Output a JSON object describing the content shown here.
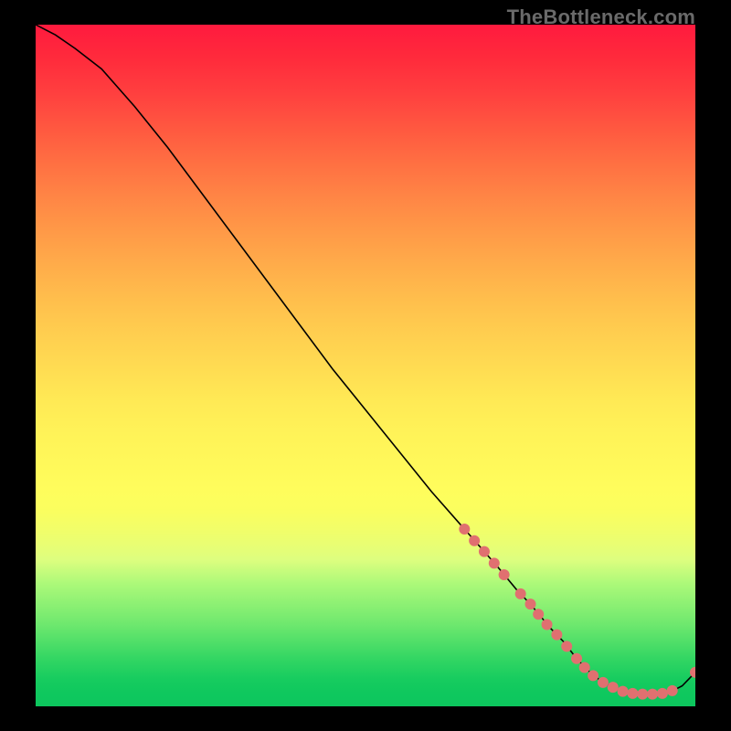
{
  "watermark": "TheBottleneck.com",
  "colors": {
    "gradient_top": "#ff1a3e",
    "gradient_mid": "#fff95a",
    "gradient_bottom": "#0cc65d",
    "line": "#000000",
    "marker": "#e07070",
    "background": "#000000"
  },
  "chart_data": {
    "type": "line",
    "title": "",
    "xlabel": "",
    "ylabel": "",
    "xlim": [
      0,
      100
    ],
    "ylim": [
      0,
      100
    ],
    "x": [
      0,
      3,
      6,
      10,
      15,
      20,
      25,
      30,
      35,
      40,
      45,
      50,
      55,
      60,
      65,
      70,
      73,
      75,
      78,
      80,
      82,
      84,
      86,
      88,
      90,
      92,
      94,
      96,
      98,
      100
    ],
    "y": [
      100,
      98.5,
      96.5,
      93.5,
      88,
      82,
      75.5,
      69,
      62.5,
      56,
      49.5,
      43.5,
      37.5,
      31.5,
      26,
      20.5,
      17,
      15,
      11.5,
      9.5,
      7,
      5,
      3.5,
      2.5,
      2,
      1.8,
      1.8,
      2,
      3,
      5
    ],
    "markers": [
      {
        "x": 65.0,
        "y": 26.0
      },
      {
        "x": 66.5,
        "y": 24.3
      },
      {
        "x": 68.0,
        "y": 22.7
      },
      {
        "x": 69.5,
        "y": 21.0
      },
      {
        "x": 71.0,
        "y": 19.3
      },
      {
        "x": 73.5,
        "y": 16.5
      },
      {
        "x": 75.0,
        "y": 15.0
      },
      {
        "x": 76.2,
        "y": 13.5
      },
      {
        "x": 77.5,
        "y": 12.0
      },
      {
        "x": 79.0,
        "y": 10.5
      },
      {
        "x": 80.5,
        "y": 8.8
      },
      {
        "x": 82.0,
        "y": 7.0
      },
      {
        "x": 83.2,
        "y": 5.7
      },
      {
        "x": 84.5,
        "y": 4.5
      },
      {
        "x": 86.0,
        "y": 3.5
      },
      {
        "x": 87.5,
        "y": 2.8
      },
      {
        "x": 89.0,
        "y": 2.2
      },
      {
        "x": 90.5,
        "y": 1.9
      },
      {
        "x": 92.0,
        "y": 1.8
      },
      {
        "x": 93.5,
        "y": 1.8
      },
      {
        "x": 95.0,
        "y": 1.9
      },
      {
        "x": 96.5,
        "y": 2.3
      },
      {
        "x": 100.0,
        "y": 5.0
      }
    ]
  }
}
